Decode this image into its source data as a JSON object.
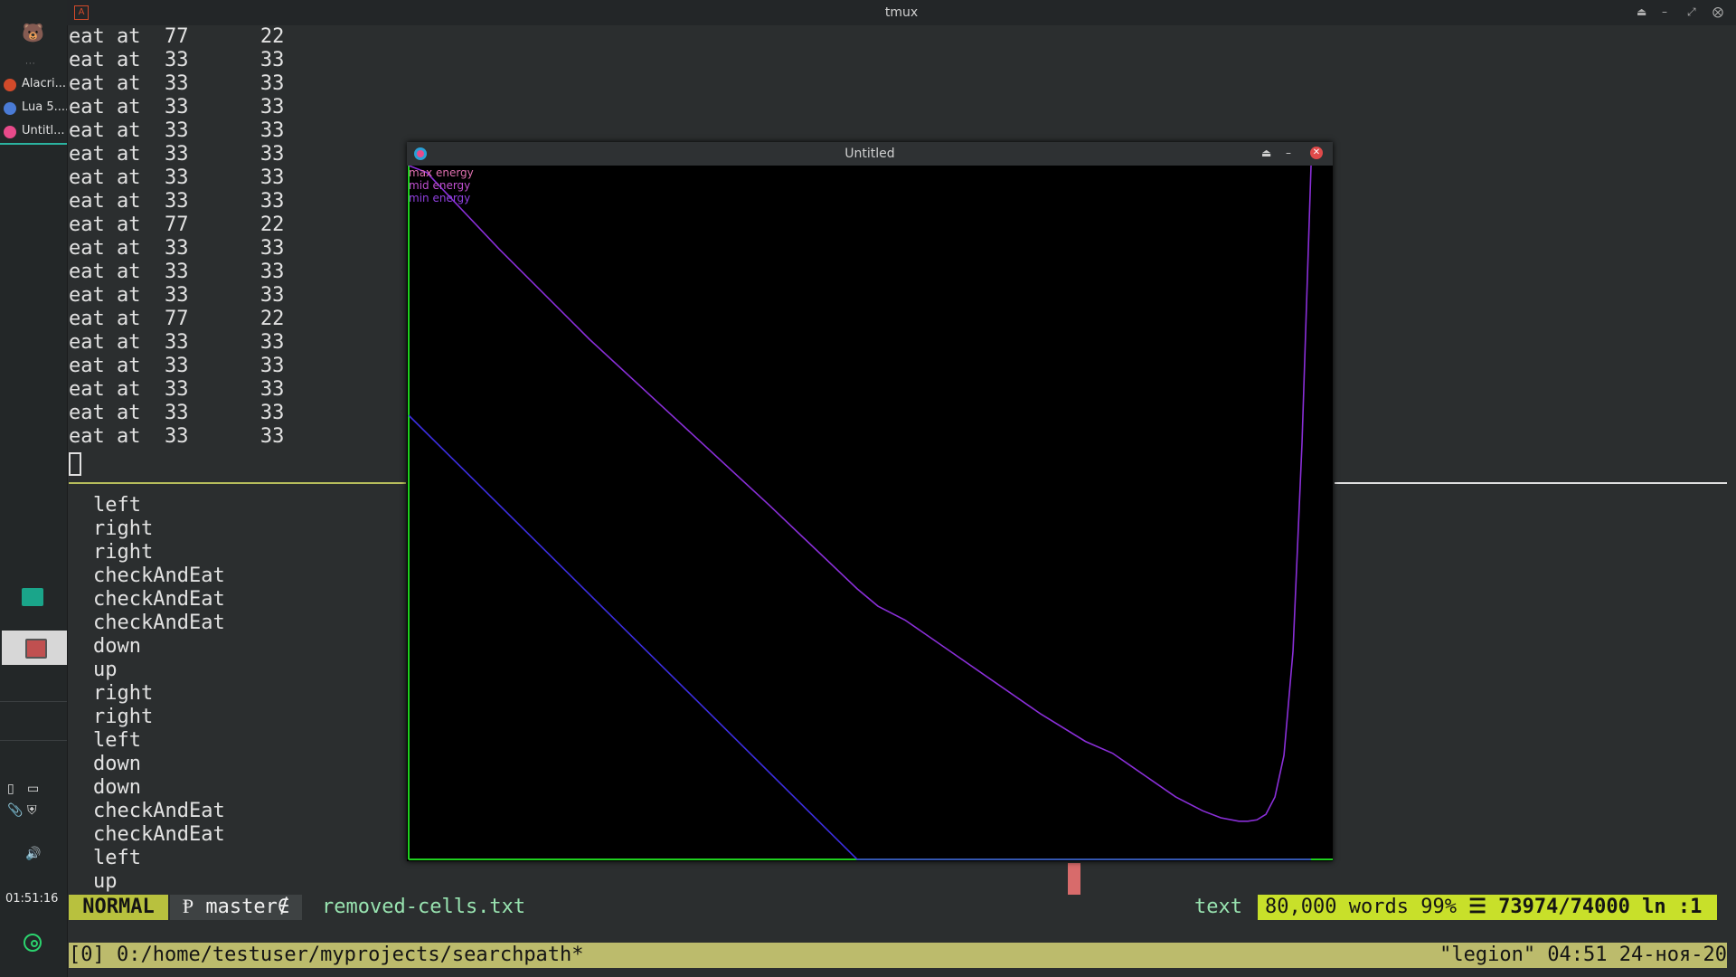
{
  "titlebar": {
    "title": "tmux"
  },
  "taskbar": {
    "tasks": [
      {
        "label": "Alacri...",
        "color": "#d24a2a"
      },
      {
        "label": "Lua 5....",
        "color": "#4a7bd6"
      },
      {
        "label": "Untitl...",
        "color": "#e84a8a"
      }
    ],
    "clock": "01:51:16"
  },
  "terminal_top": {
    "lines": [
      "eat at  77      22",
      "eat at  33      33",
      "eat at  33      33",
      "eat at  33      33",
      "eat at  33      33",
      "eat at  33      33",
      "eat at  33      33",
      "eat at  33      33",
      "eat at  77      22",
      "eat at  33      33",
      "eat at  33      33",
      "eat at  33      33",
      "eat at  77      22",
      "eat at  33      33",
      "eat at  33      33",
      "eat at  33      33",
      "eat at  33      33",
      "eat at  33      33"
    ]
  },
  "terminal_bottom": {
    "lines": [
      "left",
      "right",
      "right",
      "checkAndEat",
      "checkAndEat",
      "checkAndEat",
      "down",
      "up",
      "right",
      "right",
      "left",
      "down",
      "down",
      "checkAndEat",
      "checkAndEat",
      "left",
      "up"
    ]
  },
  "statusline": {
    "mode": "NORMAL",
    "branch": "Ᵽ master∉",
    "file": "removed-cells.txt",
    "filetype": "text",
    "words": "80,000 words",
    "percent": "99%",
    "position": "☰ 73974/74000",
    "ln": "ln :1"
  },
  "tmux": {
    "left": "[0] 0:/home/testuser/myprojects/searchpath*",
    "right": "\"legion\" 04:51 24-ноя-20"
  },
  "plot_window": {
    "title": "Untitled",
    "legend": [
      {
        "label": "max energy",
        "color": "#e070b0"
      },
      {
        "label": "mid energy",
        "color": "#c050d0"
      },
      {
        "label": "min energy",
        "color": "#9040e0"
      }
    ]
  },
  "chart_data": {
    "type": "line",
    "title": "",
    "xlabel": "",
    "ylabel": "",
    "grid": false,
    "legend_placement": "top-left",
    "xlim": [
      0,
      100
    ],
    "ylim": [
      0,
      100
    ],
    "series": [
      {
        "name": "max energy",
        "color": "#8a2fd8",
        "x": [
          0,
          2,
          10,
          20,
          30,
          40,
          49.7,
          52,
          55,
          60,
          65,
          70,
          75,
          78,
          80,
          85,
          88,
          90,
          92,
          93,
          94,
          95,
          96,
          97,
          98,
          99,
          99.5,
          100
        ],
        "y": [
          100,
          99,
          88,
          75,
          63,
          51,
          39,
          36.5,
          34.5,
          30,
          25.5,
          21,
          17,
          15.3,
          13.5,
          9,
          7,
          6,
          5.5,
          5.5,
          5.7,
          6.5,
          9,
          15,
          30,
          60,
          80,
          100
        ]
      },
      {
        "name": "min energy",
        "color": "#3c2ee0",
        "x": [
          0,
          49.7,
          100
        ],
        "y": [
          64,
          0,
          0
        ]
      }
    ]
  },
  "colors": {
    "mode_bg": "#b8c13e",
    "info_bg": "#c8e02a",
    "tmux_bg": "#bcbb6c",
    "axis_green": "#1fd01f"
  }
}
